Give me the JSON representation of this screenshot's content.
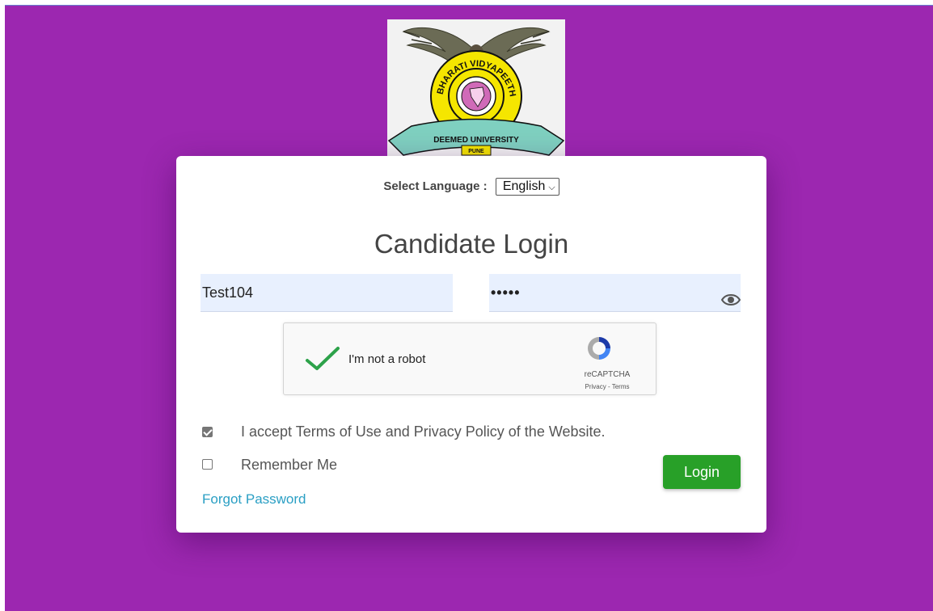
{
  "language": {
    "label": "Select Language :",
    "selected": "English"
  },
  "login": {
    "title": "Candidate Login",
    "username_value": "Test104",
    "password_mask": "•••••"
  },
  "captcha": {
    "text": "I'm not a robot",
    "brand": "reCAPTCHA",
    "links": "Privacy - Terms"
  },
  "terms": {
    "label": "I accept Terms of Use and Privacy Policy of the Website.",
    "checked": true
  },
  "remember": {
    "label": "Remember Me",
    "checked": false
  },
  "buttons": {
    "login": "Login"
  },
  "links": {
    "forgot": "Forgot Password"
  },
  "logo": {
    "arc_top": "BHARATI VIDYAPEETH",
    "ribbon": "DEEMED UNIVERSITY",
    "city": "PUNE"
  },
  "colors": {
    "background": "#9c27b0",
    "login_button": "#28a028",
    "input_fill": "#e8f0fe",
    "link": "#2a9fc4"
  },
  "icons": [
    "university-logo",
    "eye-icon",
    "checkmark-icon",
    "recaptcha-icon"
  ]
}
